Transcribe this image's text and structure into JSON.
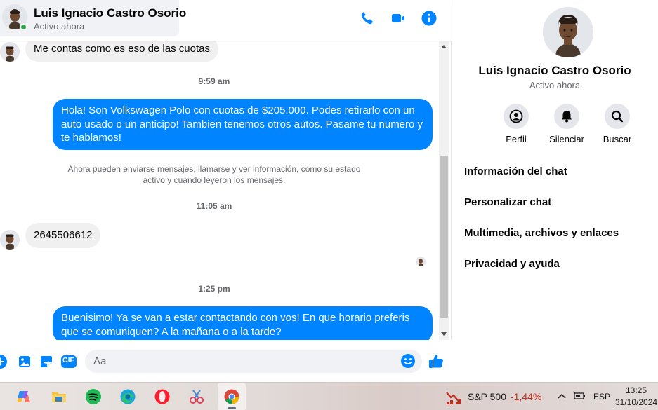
{
  "chat_header": {
    "name": "Luis Ignacio Castro Osorio",
    "status": "Activo ahora"
  },
  "messages": {
    "incoming_1": "Me contas como es eso de las cuotas",
    "timestamp_1": "9:59 am",
    "outgoing_1": "Hola! Son Volkswagen Polo con cuotas de $205.000. Podes retirarlo con un auto usado o un anticipo! Tambien tenemos otros autos. Pasame tu numero y te hablamos!",
    "system_notice": "Ahora pueden enviarse mensajes, llamarse y ver información, como su estado activo y cuándo leyeron los mensajes.",
    "timestamp_2": "11:05 am",
    "incoming_2": "2645506612",
    "timestamp_3": "1:25 pm",
    "outgoing_2": "Buenisimo! Ya se van a estar contactando con vos! En que horario preferis que se comuniquen? A la mañana o a la tarde?"
  },
  "composer": {
    "placeholder": "Aa",
    "gif_label": "GIF"
  },
  "panel": {
    "name": "Luis Ignacio Castro Osorio",
    "status": "Activo ahora",
    "actions": {
      "profile": "Perfil",
      "mute": "Silenciar",
      "search": "Buscar"
    },
    "links": {
      "chat_info": "Información del chat",
      "customize": "Personalizar chat",
      "media": "Multimedia, archivos y enlaces",
      "privacy": "Privacidad y ayuda"
    }
  },
  "taskbar": {
    "ticker_name": "S&P 500",
    "ticker_value": "-1,44%",
    "language": "ESP",
    "time": "13:25",
    "date": "31/10/2024"
  },
  "colors": {
    "accent": "#0084ff",
    "online": "#31a24c",
    "negative": "#c42b1c"
  }
}
